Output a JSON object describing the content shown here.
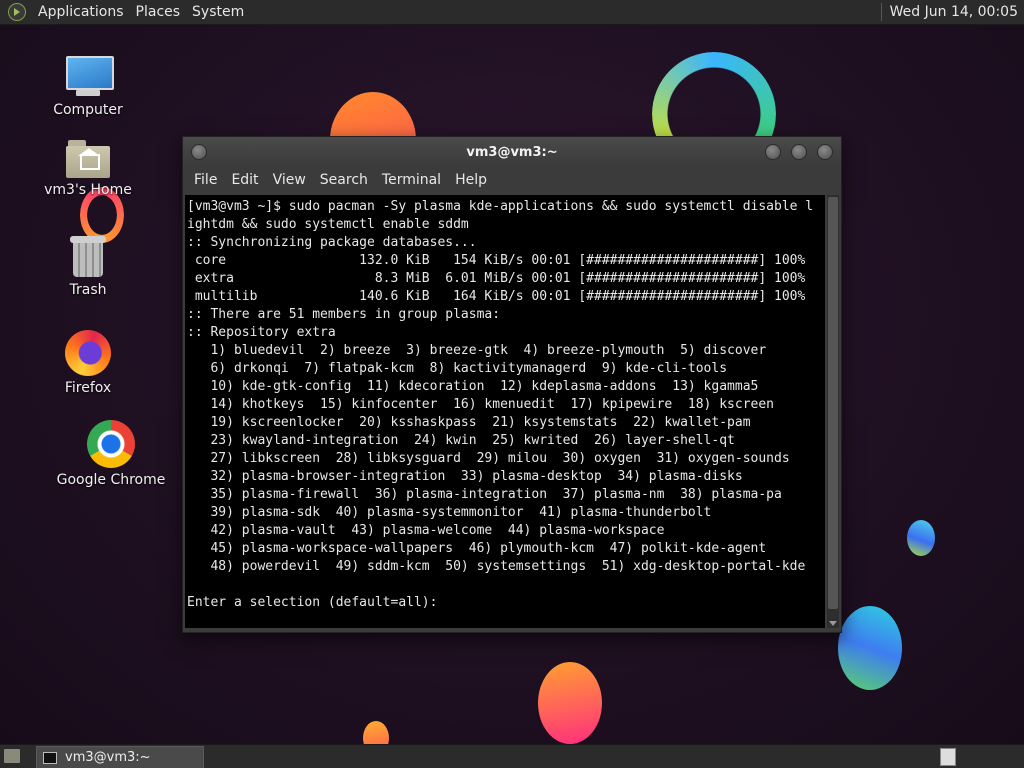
{
  "top_panel": {
    "menus": [
      "Applications",
      "Places",
      "System"
    ],
    "clock": "Wed Jun 14, 00:05"
  },
  "desktop_icons": [
    {
      "label": "Computer",
      "icon": "computer-icon"
    },
    {
      "label": "vm3's Home",
      "icon": "home-folder-icon"
    },
    {
      "label": "Trash",
      "icon": "trash-icon"
    },
    {
      "label": "Firefox",
      "icon": "firefox-icon"
    },
    {
      "label": "Google Chrome",
      "icon": "chrome-icon"
    }
  ],
  "terminal": {
    "title": "vm3@vm3:~",
    "menu": [
      "File",
      "Edit",
      "View",
      "Search",
      "Terminal",
      "Help"
    ],
    "lines": [
      "[vm3@vm3 ~]$ sudo pacman -Sy plasma kde-applications && sudo systemctl disable l",
      "ightdm && sudo systemctl enable sddm",
      ":: Synchronizing package databases...",
      " core                 132.0 KiB   154 KiB/s 00:01 [######################] 100%",
      " extra                  8.3 MiB  6.01 MiB/s 00:01 [######################] 100%",
      " multilib             140.6 KiB   164 KiB/s 00:01 [######################] 100%",
      ":: There are 51 members in group plasma:",
      ":: Repository extra",
      "   1) bluedevil  2) breeze  3) breeze-gtk  4) breeze-plymouth  5) discover",
      "   6) drkonqi  7) flatpak-kcm  8) kactivitymanagerd  9) kde-cli-tools",
      "   10) kde-gtk-config  11) kdecoration  12) kdeplasma-addons  13) kgamma5",
      "   14) khotkeys  15) kinfocenter  16) kmenuedit  17) kpipewire  18) kscreen",
      "   19) kscreenlocker  20) ksshaskpass  21) ksystemstats  22) kwallet-pam",
      "   23) kwayland-integration  24) kwin  25) kwrited  26) layer-shell-qt",
      "   27) libkscreen  28) libksysguard  29) milou  30) oxygen  31) oxygen-sounds",
      "   32) plasma-browser-integration  33) plasma-desktop  34) plasma-disks",
      "   35) plasma-firewall  36) plasma-integration  37) plasma-nm  38) plasma-pa",
      "   39) plasma-sdk  40) plasma-systemmonitor  41) plasma-thunderbolt",
      "   42) plasma-vault  43) plasma-welcome  44) plasma-workspace",
      "   45) plasma-workspace-wallpapers  46) plymouth-kcm  47) polkit-kde-agent",
      "   48) powerdevil  49) sddm-kcm  50) systemsettings  51) xdg-desktop-portal-kde",
      "",
      "Enter a selection (default=all):"
    ]
  },
  "taskbar": {
    "tasks": [
      {
        "label": "vm3@vm3:~",
        "icon": "terminal-icon"
      }
    ]
  }
}
